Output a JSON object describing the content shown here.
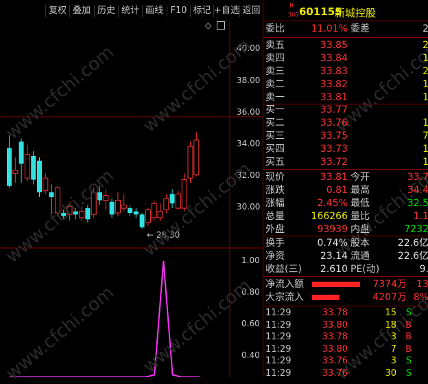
{
  "toolbar": {
    "buttons": [
      "复权",
      "叠加",
      "历史",
      "统计",
      "画线",
      "F10",
      "标记",
      "+自选",
      "返回"
    ]
  },
  "chart": {
    "price_ticks": [
      "40.00",
      "38.00",
      "36.00",
      "34.00",
      "32.00",
      "30.00"
    ],
    "low_annotation": "← 28.30",
    "indicator_ticks": [
      "1.00",
      "0.80",
      "0.60",
      "0.40"
    ]
  },
  "chart_data": {
    "type": "candlestick",
    "ylim": [
      28,
      41
    ],
    "candles": [
      {
        "o": 31.0,
        "c": 33.4,
        "h": 34.2,
        "l": 30.9,
        "up": false
      },
      {
        "o": 31.8,
        "c": 32.0,
        "h": 32.8,
        "l": 31.2,
        "up": true
      },
      {
        "o": 32.4,
        "c": 33.8,
        "h": 34.0,
        "l": 31.2,
        "up": false
      },
      {
        "o": 31.5,
        "c": 33.0,
        "h": 33.6,
        "l": 31.3,
        "up": true
      },
      {
        "o": 32.9,
        "c": 31.4,
        "h": 33.2,
        "l": 31.1,
        "up": false
      },
      {
        "o": 32.6,
        "c": 30.6,
        "h": 32.8,
        "l": 30.3,
        "up": false
      },
      {
        "o": 30.7,
        "c": 31.5,
        "h": 31.8,
        "l": 30.5,
        "up": true
      },
      {
        "o": 30.6,
        "c": 30.3,
        "h": 31.1,
        "l": 29.2,
        "up": false
      },
      {
        "o": 29.3,
        "c": 30.9,
        "h": 31.0,
        "l": 29.1,
        "up": true
      },
      {
        "o": 29.3,
        "c": 29.1,
        "h": 29.5,
        "l": 28.9,
        "up": false
      },
      {
        "o": 29.2,
        "c": 29.7,
        "h": 29.9,
        "l": 28.8,
        "up": true
      },
      {
        "o": 29.4,
        "c": 29.2,
        "h": 29.6,
        "l": 28.9,
        "up": false
      },
      {
        "o": 29.0,
        "c": 29.4,
        "h": 29.7,
        "l": 28.8,
        "up": true
      },
      {
        "o": 28.9,
        "c": 29.6,
        "h": 29.8,
        "l": 28.7,
        "up": false
      },
      {
        "o": 29.2,
        "c": 30.6,
        "h": 30.9,
        "l": 29.0,
        "up": true
      },
      {
        "o": 30.6,
        "c": 30.1,
        "h": 31.0,
        "l": 29.8,
        "up": false
      },
      {
        "o": 30.1,
        "c": 30.4,
        "h": 30.8,
        "l": 29.5,
        "up": true
      },
      {
        "o": 30.0,
        "c": 29.2,
        "h": 30.2,
        "l": 29.0,
        "up": false
      },
      {
        "o": 29.3,
        "c": 30.1,
        "h": 30.6,
        "l": 29.1,
        "up": true
      },
      {
        "o": 29.8,
        "c": 29.6,
        "h": 30.5,
        "l": 29.4,
        "up": true
      },
      {
        "o": 29.6,
        "c": 29.3,
        "h": 29.8,
        "l": 29.1,
        "up": false
      },
      {
        "o": 29.4,
        "c": 29.2,
        "h": 29.6,
        "l": 29.0,
        "up": false
      },
      {
        "o": 29.2,
        "c": 28.4,
        "h": 29.3,
        "l": 28.3,
        "up": false
      },
      {
        "o": 28.7,
        "c": 29.5,
        "h": 29.6,
        "l": 28.5,
        "up": true
      },
      {
        "o": 29.0,
        "c": 29.9,
        "h": 30.1,
        "l": 28.8,
        "up": true
      },
      {
        "o": 29.4,
        "c": 29.0,
        "h": 29.9,
        "l": 28.8,
        "up": true
      },
      {
        "o": 29.5,
        "c": 30.2,
        "h": 30.5,
        "l": 29.3,
        "up": true
      },
      {
        "o": 29.9,
        "c": 30.5,
        "h": 30.8,
        "l": 29.6,
        "up": false
      },
      {
        "o": 29.6,
        "c": 30.5,
        "h": 30.7,
        "l": 29.5,
        "up": true
      },
      {
        "o": 29.6,
        "c": 31.4,
        "h": 31.8,
        "l": 29.4,
        "up": true
      },
      {
        "o": 31.5,
        "c": 33.5,
        "h": 33.8,
        "l": 31.2,
        "up": true
      },
      {
        "o": 31.7,
        "c": 33.9,
        "h": 34.4,
        "l": 31.6,
        "up": true
      }
    ],
    "indicator": [
      0,
      0,
      0,
      0,
      0,
      0,
      0,
      0,
      0,
      0,
      0,
      0,
      0,
      0,
      0,
      0,
      0.02,
      1.0,
      0.02,
      0,
      0,
      0
    ]
  },
  "header": {
    "code": "601155",
    "name": "新城控股",
    "badge_top": "R",
    "badge_bottom": "300"
  },
  "ratio": {
    "label1": "委比",
    "val1": "11.01%",
    "label2": "委差",
    "val2": "2"
  },
  "asks": [
    {
      "label": "卖五",
      "price": "33.85",
      "vol": "2"
    },
    {
      "label": "卖四",
      "price": "33.84",
      "vol": "1"
    },
    {
      "label": "卖三",
      "price": "33.83",
      "vol": "2"
    },
    {
      "label": "卖二",
      "price": "33.82",
      "vol": "1"
    },
    {
      "label": "卖一",
      "price": "33.81",
      "vol": "1"
    }
  ],
  "bids": [
    {
      "label": "买一",
      "price": "33.77",
      "vol": ""
    },
    {
      "label": "买二",
      "price": "33.76",
      "vol": "1"
    },
    {
      "label": "买三",
      "price": "33.75",
      "vol": "7"
    },
    {
      "label": "买四",
      "price": "33.73",
      "vol": "1"
    },
    {
      "label": "买五",
      "price": "33.72",
      "vol": "1"
    }
  ],
  "quote": [
    {
      "l1": "现价",
      "v1": "33.81",
      "c1": "red",
      "l2": "今开",
      "v2": "33.7",
      "c2": "red"
    },
    {
      "l1": "涨跌",
      "v1": "0.81",
      "c1": "red",
      "l2": "最高",
      "v2": "34.4",
      "c2": "red"
    },
    {
      "l1": "涨幅",
      "v1": "2.45%",
      "c1": "red",
      "l2": "最低",
      "v2": "32.5",
      "c2": "green"
    },
    {
      "l1": "总量",
      "v1": "166266",
      "c1": "yellow",
      "l2": "量比",
      "v2": "1.1",
      "c2": "red"
    },
    {
      "l1": "外盘",
      "v1": "93939",
      "c1": "red",
      "l2": "内盘",
      "v2": "7232",
      "c2": "green"
    }
  ],
  "stats": [
    {
      "l1": "换手",
      "v1": "0.74%",
      "l2": "股本",
      "v2": "22.6亿"
    },
    {
      "l1": "净资",
      "v1": "23.14",
      "l2": "流通",
      "v2": "22.6亿"
    },
    {
      "l1": "收益(三)",
      "v1": "2.610",
      "l2": "PE(动)",
      "v2": "9."
    }
  ],
  "flows": [
    {
      "label": "净流入额",
      "value": "7374万",
      "pct": "13",
      "bar": 0.8
    },
    {
      "label": "大宗流入",
      "value": "4207万",
      "pct": "8%",
      "bar": 0.46
    }
  ],
  "ticks": [
    {
      "time": "11:29",
      "price": "33.78",
      "vol": "15",
      "side": "S"
    },
    {
      "time": "11:29",
      "price": "33.80",
      "vol": "18",
      "side": "B"
    },
    {
      "time": "11:29",
      "price": "33.78",
      "vol": "3",
      "side": "B"
    },
    {
      "time": "11:29",
      "price": "33.80",
      "vol": "7",
      "side": "B"
    },
    {
      "time": "11:29",
      "price": "33.76",
      "vol": "3",
      "side": "S"
    },
    {
      "time": "11:29",
      "price": "33.76",
      "vol": "30",
      "side": "S"
    }
  ],
  "watermark": "www.cfchi.com",
  "colors": {
    "up": "#ff3333",
    "down": "#33e0e0",
    "indicator": "#ff33ff",
    "frame": "#8b0000"
  }
}
